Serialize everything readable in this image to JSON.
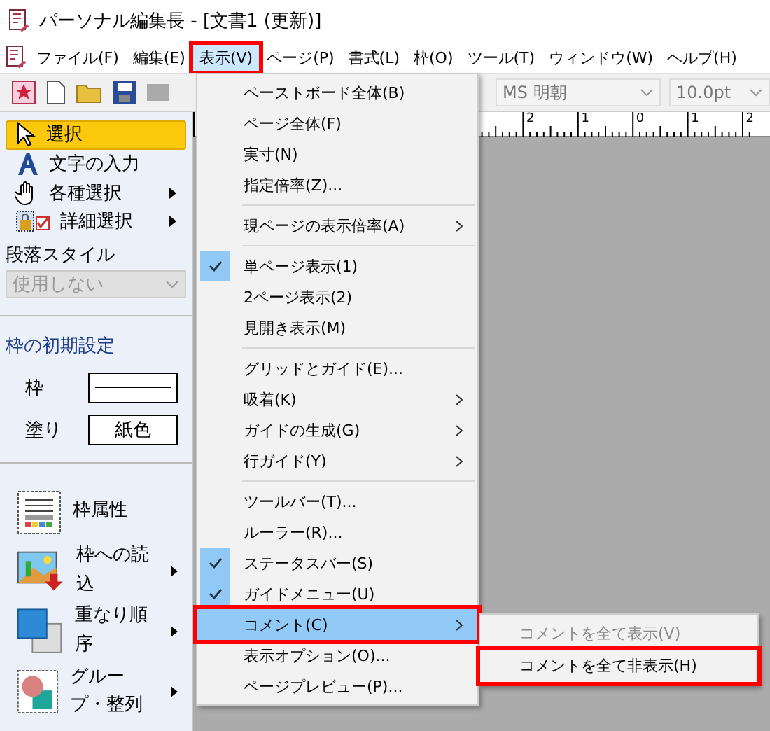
{
  "window": {
    "title": "パーソナル編集長 - [文書1 (更新)]"
  },
  "menu_bar": [
    {
      "label": "ファイル(F)",
      "selected": false
    },
    {
      "label": "編集(E)",
      "selected": false
    },
    {
      "label": "表示(V)",
      "selected": true,
      "highlighted": true
    },
    {
      "label": "ページ(P)",
      "selected": false
    },
    {
      "label": "書式(L)",
      "selected": false
    },
    {
      "label": "枠(O)",
      "selected": false
    },
    {
      "label": "ツール(T)",
      "selected": false
    },
    {
      "label": "ウィンドウ(W)",
      "selected": false
    },
    {
      "label": "ヘルプ(H)",
      "selected": false
    }
  ],
  "toolbar": {
    "font": "MS 明朝",
    "size": "10.0pt"
  },
  "ruler": {
    "labels": [
      "2",
      "1",
      "0",
      "1",
      "2"
    ]
  },
  "tools": [
    {
      "kind": "select",
      "label": "選択",
      "selected": true,
      "submenu": false
    },
    {
      "kind": "text",
      "label": "文字の入力",
      "selected": false,
      "submenu": false
    },
    {
      "kind": "hand",
      "label": "各種選択",
      "selected": false,
      "submenu": true
    },
    {
      "kind": "detail",
      "label": "詳細選択",
      "selected": false,
      "submenu": true
    }
  ],
  "paragraph_style": {
    "label": "段落スタイル",
    "value": "使用しない",
    "disabled": true
  },
  "frame_defaults": {
    "title": "枠の初期設定",
    "rows": [
      {
        "kind": "line",
        "label": "枠"
      },
      {
        "kind": "text",
        "label": "塗り",
        "value": "紙色"
      }
    ]
  },
  "big_tools": [
    {
      "kind": "attributes",
      "label": "枠属性",
      "submenu": false
    },
    {
      "kind": "load",
      "label": "枠への読込",
      "submenu": true
    },
    {
      "kind": "order",
      "label": "重なり順序",
      "submenu": true
    },
    {
      "kind": "group",
      "label": "グループ・整列",
      "submenu": true
    }
  ],
  "view_menu": [
    {
      "kind": "item",
      "label": "ペーストボード全体(B)",
      "checked": false,
      "submenu": false,
      "selected": false
    },
    {
      "kind": "item",
      "label": "ページ全体(F)",
      "checked": false,
      "submenu": false,
      "selected": false
    },
    {
      "kind": "item",
      "label": "実寸(N)",
      "checked": false,
      "submenu": false,
      "selected": false
    },
    {
      "kind": "item",
      "label": "指定倍率(Z)...",
      "checked": false,
      "submenu": false,
      "selected": false
    },
    {
      "kind": "separator"
    },
    {
      "kind": "item",
      "label": "現ページの表示倍率(A)",
      "checked": false,
      "submenu": true,
      "selected": false
    },
    {
      "kind": "separator"
    },
    {
      "kind": "item",
      "label": "単ページ表示(1)",
      "checked": true,
      "submenu": false,
      "selected": false
    },
    {
      "kind": "item",
      "label": "2ページ表示(2)",
      "checked": false,
      "submenu": false,
      "selected": false
    },
    {
      "kind": "item",
      "label": "見開き表示(M)",
      "checked": false,
      "submenu": false,
      "selected": false
    },
    {
      "kind": "separator"
    },
    {
      "kind": "item",
      "label": "グリッドとガイド(E)...",
      "checked": false,
      "submenu": false,
      "selected": false
    },
    {
      "kind": "item",
      "label": "吸着(K)",
      "checked": false,
      "submenu": true,
      "selected": false
    },
    {
      "kind": "item",
      "label": "ガイドの生成(G)",
      "checked": false,
      "submenu": true,
      "selected": false
    },
    {
      "kind": "item",
      "label": "行ガイド(Y)",
      "checked": false,
      "submenu": true,
      "selected": false
    },
    {
      "kind": "separator"
    },
    {
      "kind": "item",
      "label": "ツールバー(T)...",
      "checked": false,
      "submenu": false,
      "selected": false
    },
    {
      "kind": "item",
      "label": "ルーラー(R)...",
      "checked": false,
      "submenu": false,
      "selected": false
    },
    {
      "kind": "item",
      "label": "ステータスバー(S)",
      "checked": true,
      "submenu": false,
      "selected": false
    },
    {
      "kind": "item",
      "label": "ガイドメニュー(U)",
      "checked": true,
      "submenu": false,
      "selected": false
    },
    {
      "kind": "item",
      "label": "コメント(C)",
      "checked": false,
      "submenu": true,
      "selected": true,
      "highlighted": true
    },
    {
      "kind": "item",
      "label": "表示オプション(O)...",
      "checked": false,
      "submenu": false,
      "selected": false
    },
    {
      "kind": "item",
      "label": "ページプレビュー(P)...",
      "checked": false,
      "submenu": false,
      "selected": false
    }
  ],
  "comment_submenu": [
    {
      "label": "コメントを全て表示(V)",
      "disabled": true,
      "highlighted": false
    },
    {
      "label": "コメントを全て非表示(H)",
      "disabled": false,
      "highlighted": true
    }
  ]
}
